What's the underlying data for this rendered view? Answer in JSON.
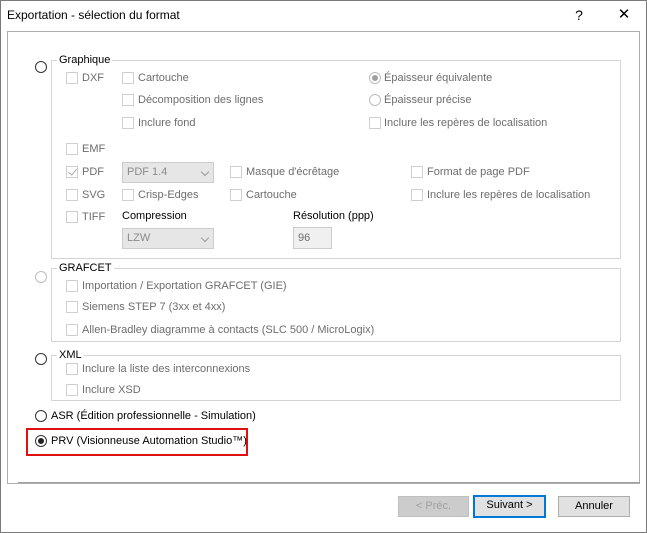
{
  "window": {
    "title": "Exportation - sélection du format",
    "help_glyph": "?",
    "close_glyph": "✕"
  },
  "graphique": {
    "label": "Graphique",
    "dxf": "DXF",
    "cartouche": "Cartouche",
    "decomposition": "Décomposition des lignes",
    "inclure_fond": "Inclure fond",
    "epaisseur_equivalente": "Épaisseur équivalente",
    "epaisseur_precise": "Épaisseur précise",
    "inclure_reperes": "Inclure les repères de localisation",
    "emf": "EMF",
    "pdf": "PDF",
    "pdf_version": "PDF 1.4",
    "masque": "Masque d'écrêtage",
    "format_page": "Format de page PDF",
    "svg": "SVG",
    "crisp_edges": "Crisp-Edges",
    "cartouche_svg": "Cartouche",
    "inclure_reperes_svg": "Inclure les repères de localisation",
    "tiff": "TIFF",
    "compression_label": "Compression",
    "compression_value": "LZW",
    "resolution_label": "Résolution (ppp)",
    "resolution_value": "96"
  },
  "grafcet": {
    "label": "GRAFCET",
    "import_export": "Importation / Exportation GRAFCET (GIE)",
    "siemens": "Siemens STEP 7 (3xx et 4xx)",
    "allen_bradley": "Allen-Bradley diagramme à contacts (SLC 500 / MicroLogix)"
  },
  "xml": {
    "label": "XML",
    "liste_interconnexions": "Inclure la liste des interconnexions",
    "inclure_xsd": "Inclure XSD"
  },
  "asr": {
    "label": "ASR (Édition professionnelle - Simulation)"
  },
  "prv": {
    "label": "PRV (Visionneuse Automation Studio™)"
  },
  "buttons": {
    "prev": "< Préc.",
    "next": "Suivant >",
    "cancel": "Annuler"
  },
  "colors": {
    "highlight": "#e01010",
    "default_button_border": "#0078d7"
  }
}
